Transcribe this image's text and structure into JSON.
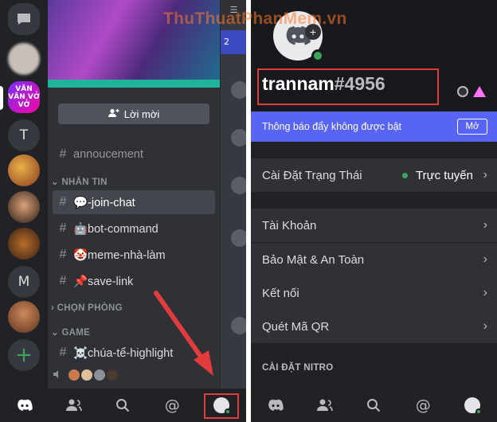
{
  "watermark": "ThuThuatPhanMem.vn",
  "left": {
    "servers": {
      "active_label": "VĂN VĂN VỞ VỞ",
      "t_label": "T",
      "m_label": "M",
      "add_label": "+"
    },
    "invite_label": "Lời mời",
    "channels": [
      {
        "hash": "#",
        "label": "annoucement"
      },
      {
        "hash": "#",
        "label": "💬-join-chat"
      },
      {
        "hash": "#",
        "label": "🤖bot-command"
      },
      {
        "hash": "#",
        "label": "🤡meme-nhà-làm"
      },
      {
        "hash": "#",
        "label": "📌save-link"
      },
      {
        "hash": "#",
        "label": "☠️chúa-tể-highlight"
      }
    ],
    "categories": {
      "nhan_tin": "NHẮN TIN",
      "chon_phong": "CHỌN PHÒNG",
      "game": "GAME"
    },
    "peek_badge": "2"
  },
  "right": {
    "username": "trannam",
    "discriminator": "#4956",
    "notice": {
      "text": "Thông báo đẩy không được bật",
      "button": "Mở"
    },
    "status_row": {
      "label": "Cài Đặt Trạng Thái",
      "value": "Trực tuyến"
    },
    "rows": [
      {
        "label": "Tài Khoản"
      },
      {
        "label": "Bảo Mật & An Toàn"
      },
      {
        "label": "Kết nối"
      },
      {
        "label": "Quét Mã QR"
      }
    ],
    "section": "CÀI ĐẶT NITRO"
  },
  "colors": {
    "accent": "#5865f2",
    "online": "#3ba55c",
    "highlight": "#e23b3b"
  }
}
